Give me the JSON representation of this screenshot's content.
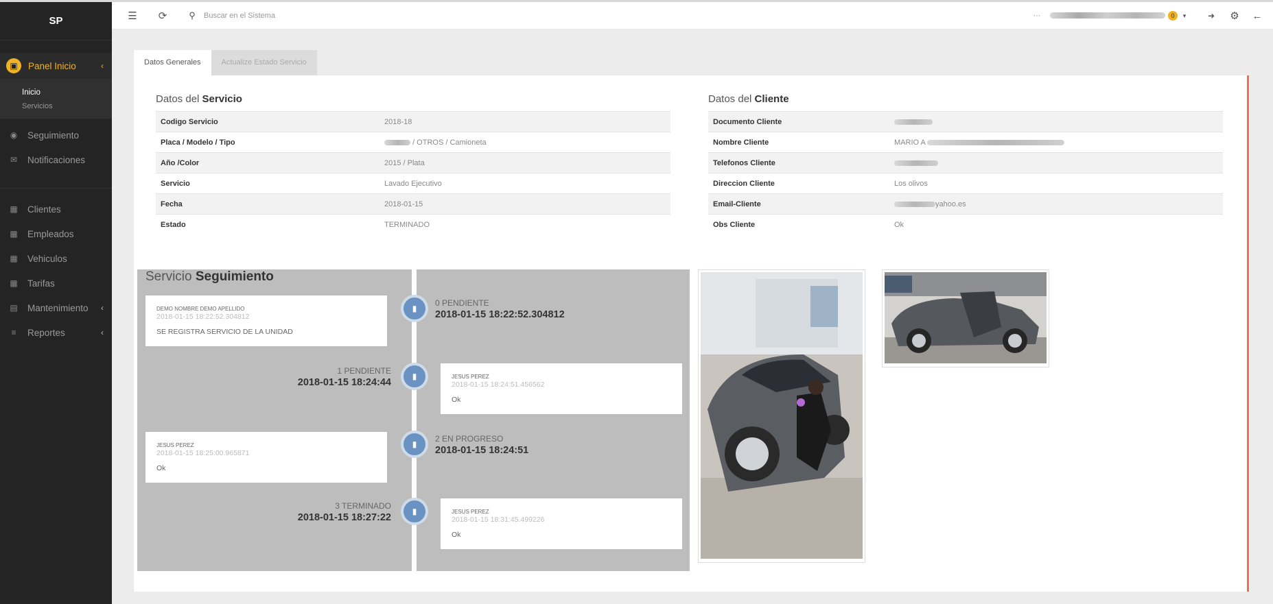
{
  "sidebar": {
    "brand": "SP",
    "panel": {
      "label": "Panel Inicio",
      "sub": [
        "Inicio",
        "Servicios"
      ]
    },
    "items_a": [
      "Seguimiento",
      "Notificaciones"
    ],
    "items_b": [
      "Clientes",
      "Empleados",
      "Vehiculos",
      "Tarifas",
      "Mantenimiento",
      "Reportes"
    ]
  },
  "topbar": {
    "search_placeholder": "Buscar en el Sistema",
    "badge": "0",
    "dots": "···"
  },
  "tabs": [
    "Datos Generales",
    "Actualize Estado Servicio"
  ],
  "servicio": {
    "title_a": "Datos del",
    "title_b": "Servicio",
    "rows": [
      {
        "k": "Codigo Servicio",
        "v": "2018-18"
      },
      {
        "k": "Placa / Modelo / Tipo",
        "v": "/ OTROS / Camioneta"
      },
      {
        "k": "Año /Color",
        "v": "2015 / Plata"
      },
      {
        "k": "Servicio",
        "v": "Lavado Ejecutivo"
      },
      {
        "k": "Fecha",
        "v": "2018-01-15"
      },
      {
        "k": "Estado",
        "v": "TERMINADO"
      }
    ]
  },
  "cliente": {
    "title_a": "Datos del",
    "title_b": "Cliente",
    "rows": [
      {
        "k": "Documento Cliente",
        "v": ""
      },
      {
        "k": "Nombre Cliente",
        "v": "MARIO A"
      },
      {
        "k": "Telefonos Cliente",
        "v": ""
      },
      {
        "k": "Direccion Cliente",
        "v": "Los olivos"
      },
      {
        "k": "Email-Cliente",
        "v": "yahoo.es"
      },
      {
        "k": "Obs Cliente",
        "v": "Ok"
      }
    ]
  },
  "timeline": {
    "title_a": "Servicio",
    "title_b": "Seguimiento",
    "events": [
      {
        "status": "0 PENDIENTE",
        "date": "2018-01-15 18:22:52.304812",
        "who": "demo nombre demo apellido",
        "when": "2018-01-15 18:22:52.304812",
        "msg": "SE REGISTRA SERVICIO DE LA UNIDAD"
      },
      {
        "status": "1 PENDIENTE",
        "date": "2018-01-15 18:24:44",
        "who": "JESUS PEREZ",
        "when": "2018-01-15 18:24:51.456562",
        "msg": "Ok"
      },
      {
        "status": "2 EN PROGRESO",
        "date": "2018-01-15 18:24:51",
        "who": "JESUS PEREZ",
        "when": "2018-01-15 18:25:00.965871",
        "msg": "Ok"
      },
      {
        "status": "3 TERMINADO",
        "date": "2018-01-15 18:27:22",
        "who": "JESUS PEREZ",
        "when": "2018-01-15 18:31:45.499226",
        "msg": "Ok"
      }
    ]
  },
  "colors": {
    "accent": "#f0b323",
    "sidebar": "#242424",
    "node": "#6a93c4",
    "panel_border": "#e8724b"
  },
  "icons": [
    "menu-icon",
    "refresh-icon",
    "search-icon",
    "logout-icon",
    "gear-icon",
    "back-arrow-icon",
    "monitor-icon",
    "eye-icon",
    "envelope-icon",
    "grid-icon",
    "table-icon",
    "list-icon",
    "comment-icon",
    "chevron-left-icon",
    "caret-down-icon"
  ]
}
